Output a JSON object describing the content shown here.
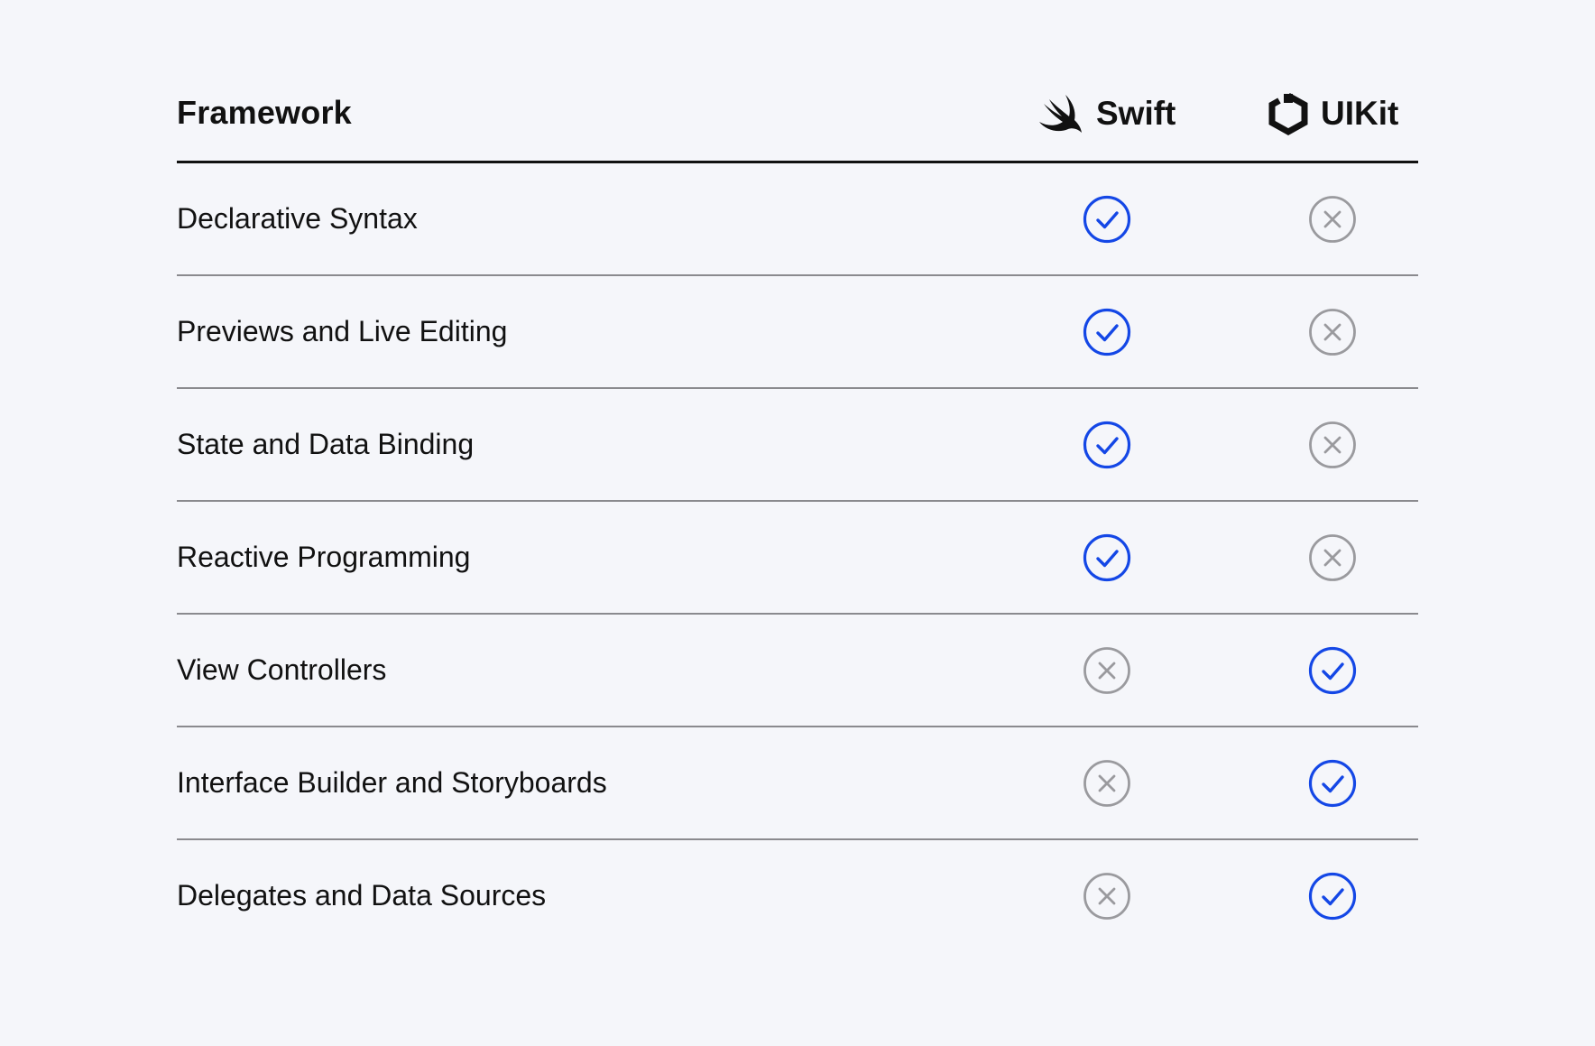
{
  "header": {
    "title": "Framework",
    "columns": [
      {
        "label": "Swift",
        "icon": "swift-logo-icon"
      },
      {
        "label": "UIKit",
        "icon": "uikit-logo-icon"
      }
    ]
  },
  "colors": {
    "background": "#f5f6fa",
    "yes": "#1447e6",
    "no": "#9a9a9e",
    "text": "#111111"
  },
  "rows": [
    {
      "label": "Declarative Syntax",
      "swift": true,
      "uikit": false
    },
    {
      "label": "Previews and Live Editing",
      "swift": true,
      "uikit": false
    },
    {
      "label": "State and Data Binding",
      "swift": true,
      "uikit": false
    },
    {
      "label": "Reactive Programming",
      "swift": true,
      "uikit": false
    },
    {
      "label": "View Controllers",
      "swift": false,
      "uikit": true
    },
    {
      "label": "Interface Builder and Storyboards",
      "swift": false,
      "uikit": true
    },
    {
      "label": "Delegates and Data Sources",
      "swift": false,
      "uikit": true
    }
  ]
}
